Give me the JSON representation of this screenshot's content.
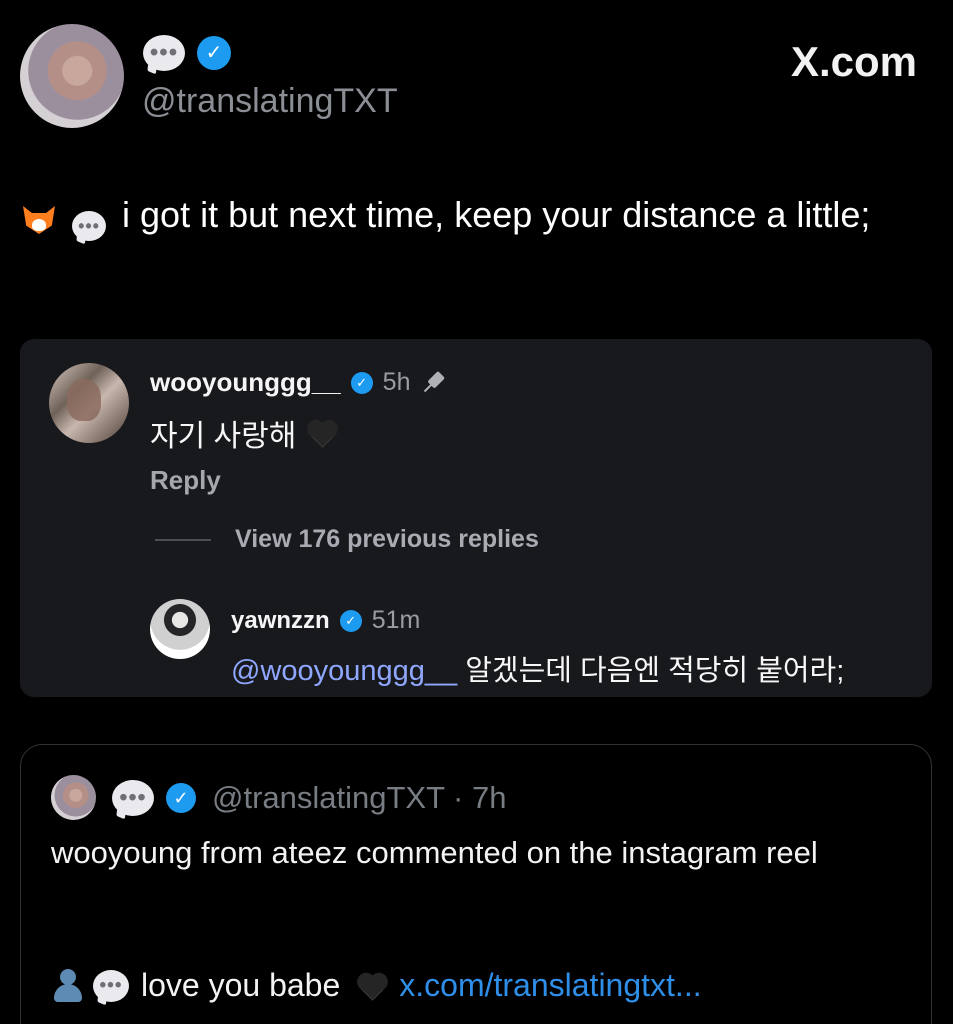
{
  "header": {
    "display_name_icon": "speech-bubble-icon",
    "verified_icon": "verified-badge-icon",
    "handle": "@translatingTXT",
    "brand": "X.com"
  },
  "post": {
    "text": "i got it but next time, keep your distance a little;",
    "emoji_icons": [
      "fox-icon",
      "speech-bubble-icon"
    ]
  },
  "instagram_thread": {
    "comment": {
      "username": "wooyounggg__",
      "time": "5h",
      "text": "자기 사랑해",
      "reply_label": "Reply",
      "icons": [
        "verified-badge-icon",
        "pin-icon",
        "black-heart-icon"
      ]
    },
    "view_previous_label": "View 176 previous replies",
    "reply": {
      "username": "yawnzzn",
      "time": "51m",
      "mention": "@wooyounggg__",
      "text": " 알겠는데 다음엔 적당히 붙어라;"
    }
  },
  "quoted_post": {
    "handle": "@translatingTXT",
    "time": " · 7h",
    "text": "wooyoung from ateez commented on the instagram reel",
    "line2_text": "love you babe",
    "link": "x.com/translatingtxt..."
  },
  "colors": {
    "background": "#000000",
    "card": "#18191d",
    "verified": "#1d9bf0",
    "mention": "#8fa7ff",
    "link": "#2f8ee8",
    "muted": "#8b8f95"
  }
}
